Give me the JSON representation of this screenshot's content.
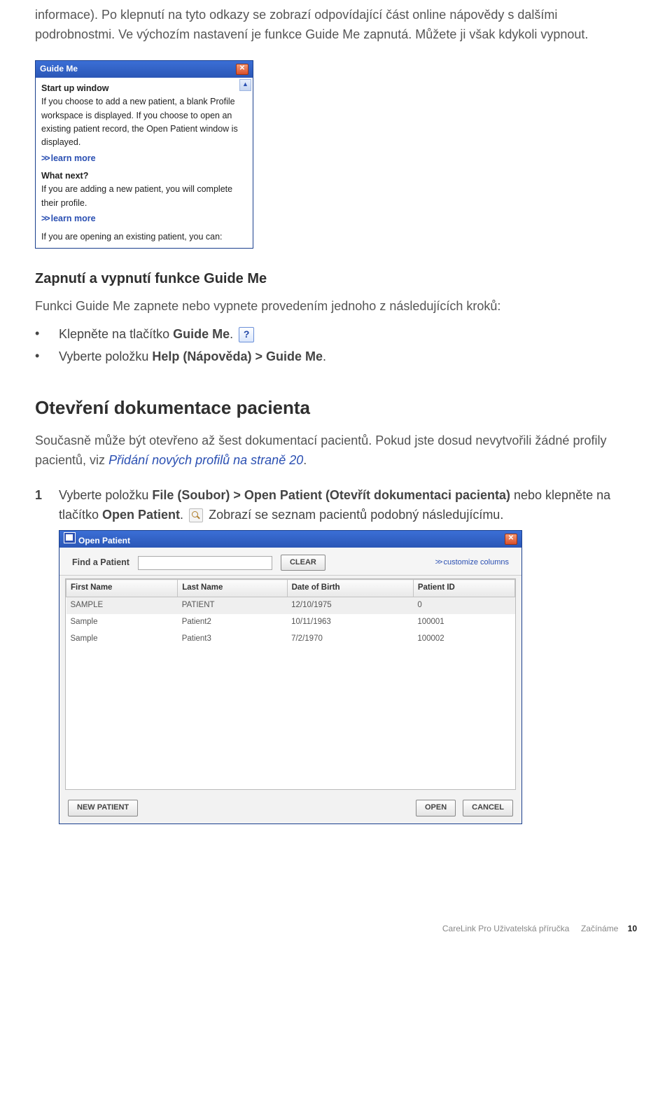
{
  "intro_para": "informace). Po klepnutí na tyto odkazy se zobrazí odpovídající část online nápovědy s dalšími podrobnostmi. Ve výchozím nastavení je funkce Guide Me zapnutá. Můžete ji však kdykoli vypnout.",
  "guide_window": {
    "title": "Guide Me",
    "h1": "Start up window",
    "body1": "If you choose to add a new patient, a blank Profile workspace is displayed. If you choose to open an existing patient record, the Open Patient window is displayed.",
    "learn1": "learn more",
    "h2": "What next?",
    "body2": "If you are adding a new patient, you will complete their profile.",
    "learn2": "learn more",
    "body3": "If you are opening an existing patient, you can:"
  },
  "section1_heading": "Zapnutí a vypnutí funkce Guide Me",
  "section1_body": "Funkci Guide Me zapnete nebo vypnete provedením jednoho z následujících kroků:",
  "bullets": [
    {
      "pre": "Klepněte na tlačítko ",
      "bold": "Guide Me",
      "post": ".",
      "icon": "question"
    },
    {
      "pre": "Vyberte položku ",
      "bold": "Help (Nápověda) > Guide Me",
      "post": ".",
      "icon": null
    }
  ],
  "section2_heading": "Otevření dokumentace pacienta",
  "section2_body_1": "Současně může být otevřeno až šest dokumentací pacientů. Pokud jste dosud nevytvořili žádné profily pacientů, viz ",
  "section2_link": "Přidání nových profilů na straně 20",
  "section2_body_2": ".",
  "step1": {
    "num": "1",
    "part1": "Vyberte položku ",
    "bold1": "File (Soubor) > Open Patient (Otevřít dokumentaci pacienta)",
    "part2": " nebo klepněte na tlačítko ",
    "bold2": "Open Patient",
    "part3": ". ",
    "part4": " Zobrazí se seznam pacientů podobný následujícímu."
  },
  "patient_window": {
    "title": "Open Patient",
    "find_label": "Find a Patient",
    "clear_btn": "CLEAR",
    "customize": "customize columns",
    "cols": [
      "First Name",
      "Last Name",
      "Date of Birth",
      "Patient ID"
    ],
    "rows": [
      [
        "SAMPLE",
        "PATIENT",
        "12/10/1975",
        "0"
      ],
      [
        "Sample",
        "Patient2",
        "10/11/1963",
        "100001"
      ],
      [
        "Sample",
        "Patient3",
        "7/2/1970",
        "100002"
      ]
    ],
    "new_btn": "NEW PATIENT",
    "open_btn": "OPEN",
    "cancel_btn": "CANCEL"
  },
  "footer": {
    "doc": "CareLink Pro Uživatelská příručka",
    "sect": "Začínáme",
    "page": "10"
  }
}
